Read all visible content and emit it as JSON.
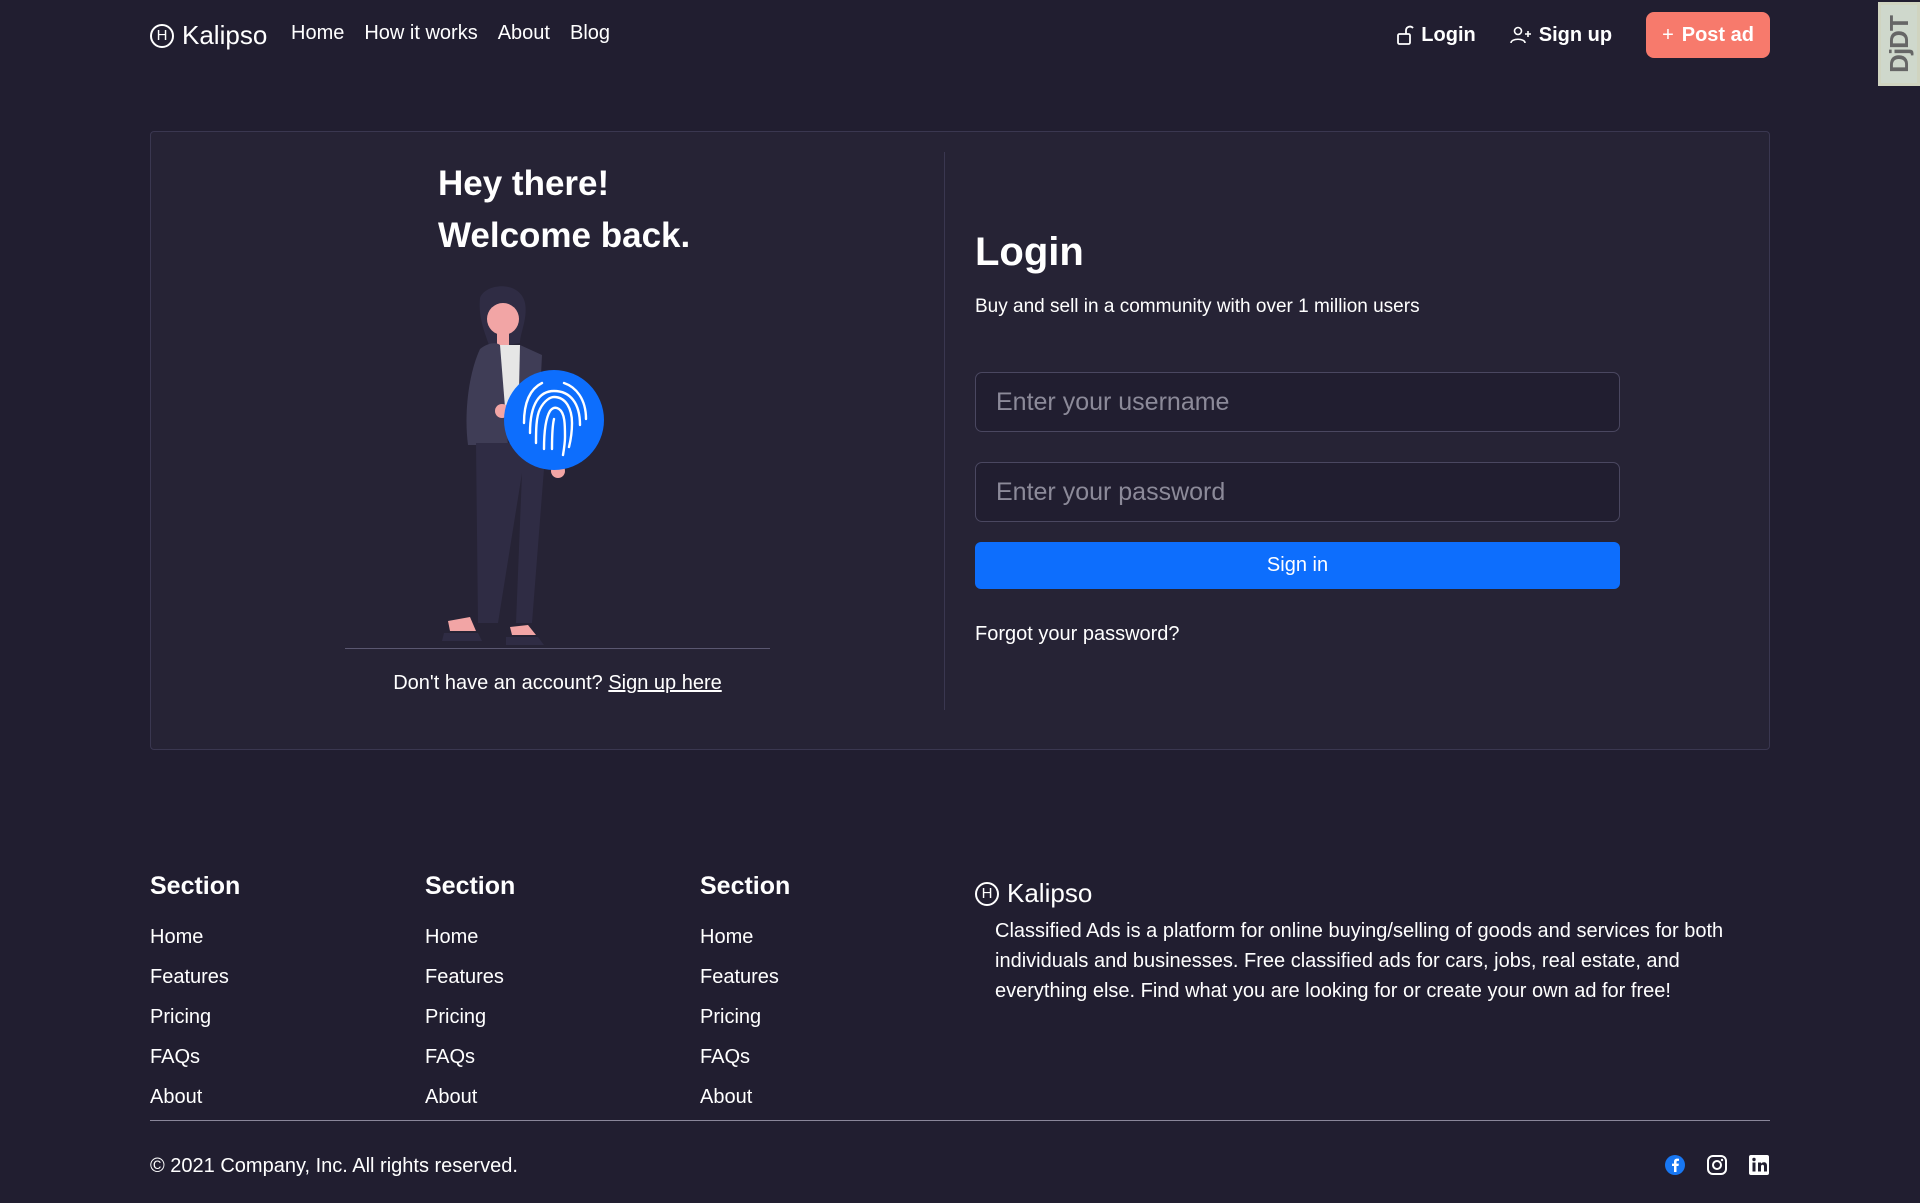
{
  "brand": {
    "name": "Kalipso",
    "mark": "H"
  },
  "nav": {
    "items": [
      "Home",
      "How it works",
      "About",
      "Blog"
    ]
  },
  "auth": {
    "login": "Login",
    "signup": "Sign up",
    "post_ad": "Post ad",
    "post_ad_prefix": "+"
  },
  "debug_toolbar": {
    "label": "DjDT"
  },
  "hero": {
    "greeting_line1": "Hey there!",
    "greeting_line2": "Welcome back.",
    "no_account": "Don't have an account?",
    "signup_link": "Sign up here"
  },
  "login": {
    "title": "Login",
    "subtitle": "Buy and sell in a community with over 1 million users",
    "username_placeholder": "Enter your username",
    "password_placeholder": "Enter your password",
    "submit": "Sign in",
    "forgot": "Forgot your password?"
  },
  "footer": {
    "sections": [
      {
        "title": "Section",
        "links": [
          "Home",
          "Features",
          "Pricing",
          "FAQs",
          "About"
        ]
      },
      {
        "title": "Section",
        "links": [
          "Home",
          "Features",
          "Pricing",
          "FAQs",
          "About"
        ]
      },
      {
        "title": "Section",
        "links": [
          "Home",
          "Features",
          "Pricing",
          "FAQs",
          "About"
        ]
      }
    ],
    "brand": "Kalipso",
    "description": "Classified Ads is a platform for online buying/selling of goods and services for both individuals and businesses. Free classified ads for cars, jobs, real estate, and everything else. Find what you are looking for or create your own ad for free!",
    "copyright": "© 2021 Company, Inc. All rights reserved.",
    "social": [
      "facebook-icon",
      "instagram-icon",
      "linkedin-icon"
    ]
  },
  "colors": {
    "background": "#211e30",
    "card": "#262335",
    "accent": "#f77a6c",
    "primary": "#0d6efd"
  }
}
